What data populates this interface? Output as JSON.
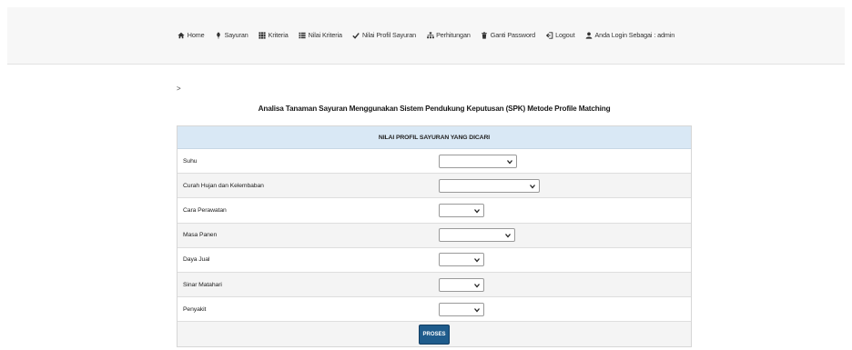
{
  "nav": {
    "items": [
      {
        "label": "Home",
        "icon": "home-icon"
      },
      {
        "label": "Sayuran",
        "icon": "leaf-icon"
      },
      {
        "label": "Kriteria",
        "icon": "grid-icon"
      },
      {
        "label": "Nilai Kriteria",
        "icon": "list-icon"
      },
      {
        "label": "Nilai Profil Sayuran",
        "icon": "check-icon"
      },
      {
        "label": "Perhitungan",
        "icon": "sitemap-icon"
      },
      {
        "label": "Ganti Password",
        "icon": "trash-icon"
      },
      {
        "label": "Logout",
        "icon": "logout-icon"
      },
      {
        "label": "Anda Login Sebagai : admin",
        "icon": "user-icon"
      }
    ]
  },
  "breadcrumb": ">",
  "title": "Analisa Tanaman Sayuran Menggunakan Sistem Pendukung Keputusan (SPK) Metode Profile Matching",
  "table": {
    "header": "NILAI PROFIL SAYURAN YANG DICARI",
    "rows": [
      {
        "label": "Suhu",
        "value": ""
      },
      {
        "label": "Curah Hujan dan Kelembaban",
        "value": ""
      },
      {
        "label": "Cara Perawatan",
        "value": ""
      },
      {
        "label": "Masa Panen",
        "value": ""
      },
      {
        "label": "Daya Jual",
        "value": ""
      },
      {
        "label": "Sinar Matahari",
        "value": ""
      },
      {
        "label": "Penyakit",
        "value": ""
      }
    ],
    "submit_label": "PROSES"
  }
}
